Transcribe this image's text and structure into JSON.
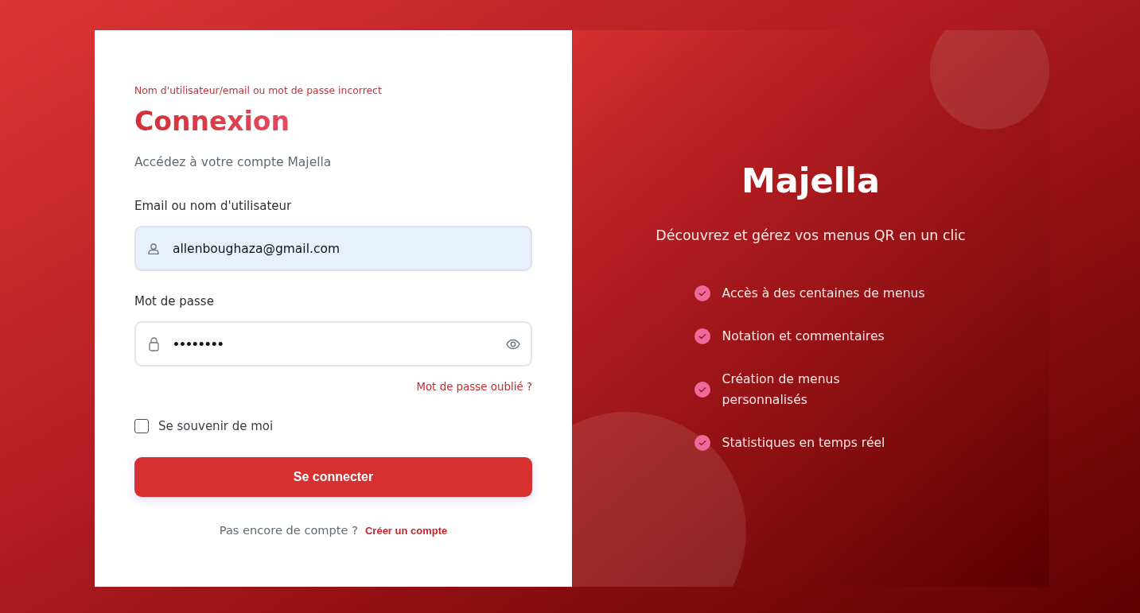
{
  "login": {
    "error": "Nom d'utilisateur/email ou mot de passe incorrect",
    "title": "Connexion",
    "subtitle": "Accédez à votre compte Majella",
    "fields": [
      {
        "kind": "email",
        "label": "Email ou nom d'utilisateur",
        "value": "allenboughaza@gmail.com",
        "autofilled": true
      },
      {
        "kind": "password",
        "label": "Mot de passe",
        "value": "••••••••",
        "autofilled": false
      }
    ],
    "forgot_link": "Mot de passe oublié ?",
    "remember": {
      "label": "Se souvenir de moi",
      "checked": false
    },
    "submit": "Se connecter",
    "signup": {
      "prompt": "Pas encore de compte ?",
      "link": "Créer un compte"
    }
  },
  "brand": {
    "name": "Majella",
    "tagline": "Découvrez et gérez vos menus QR en un clic",
    "features": [
      "Accès à des centaines de menus",
      "Notation et commentaires",
      "Création de menus personnalisés",
      "Statistiques en temps réel"
    ]
  }
}
